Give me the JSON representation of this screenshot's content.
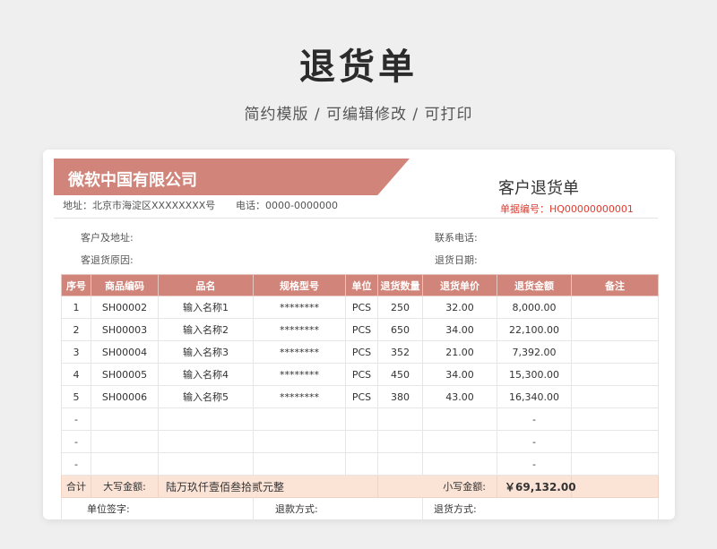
{
  "header": {
    "title": "退货单",
    "subtitle": "简约模版 /  可编辑修改 / 可打印"
  },
  "sheet": {
    "company": "微软中国有限公司",
    "doc_title": "客户退货单",
    "doc_no": "单据编号：HQ00000000001",
    "address": "地址：北京市海淀区XXXXXXXX号",
    "phone": "电话：0000-0000000",
    "customer_label": "客户及地址:",
    "contact_label": "联系电话:",
    "reason_label": "客退货原因:",
    "date_label": "退货日期:"
  },
  "table": {
    "columns": [
      "序号",
      "商品编码",
      "品名",
      "规格型号",
      "单位",
      "退货数量",
      "退货单价",
      "退货金额",
      "备注"
    ],
    "rows": [
      [
        "1",
        "SH00002",
        "输入名称1",
        "********",
        "PCS",
        "250",
        "32.00",
        "8,000.00",
        ""
      ],
      [
        "2",
        "SH00003",
        "输入名称2",
        "********",
        "PCS",
        "650",
        "34.00",
        "22,100.00",
        ""
      ],
      [
        "3",
        "SH00004",
        "输入名称3",
        "********",
        "PCS",
        "352",
        "21.00",
        "7,392.00",
        ""
      ],
      [
        "4",
        "SH00005",
        "输入名称4",
        "********",
        "PCS",
        "450",
        "34.00",
        "15,300.00",
        ""
      ],
      [
        "5",
        "SH00006",
        "输入名称5",
        "********",
        "PCS",
        "380",
        "43.00",
        "16,340.00",
        ""
      ],
      [
        "-",
        "",
        "",
        "",
        "",
        "",
        "",
        "-",
        ""
      ],
      [
        "-",
        "",
        "",
        "",
        "",
        "",
        "",
        "-",
        ""
      ],
      [
        "-",
        "",
        "",
        "",
        "",
        "",
        "",
        "-",
        ""
      ]
    ],
    "total": {
      "label": "合计",
      "upper_label": "大写金额:",
      "upper_value": "陆万玖仟壹佰叁拾贰元整",
      "lower_label": "小写金额:",
      "lower_value": "￥69,132.00"
    },
    "sign": {
      "unit_sign": "单位签字:",
      "refund_method": "退款方式:",
      "return_method": "退货方式:"
    }
  }
}
